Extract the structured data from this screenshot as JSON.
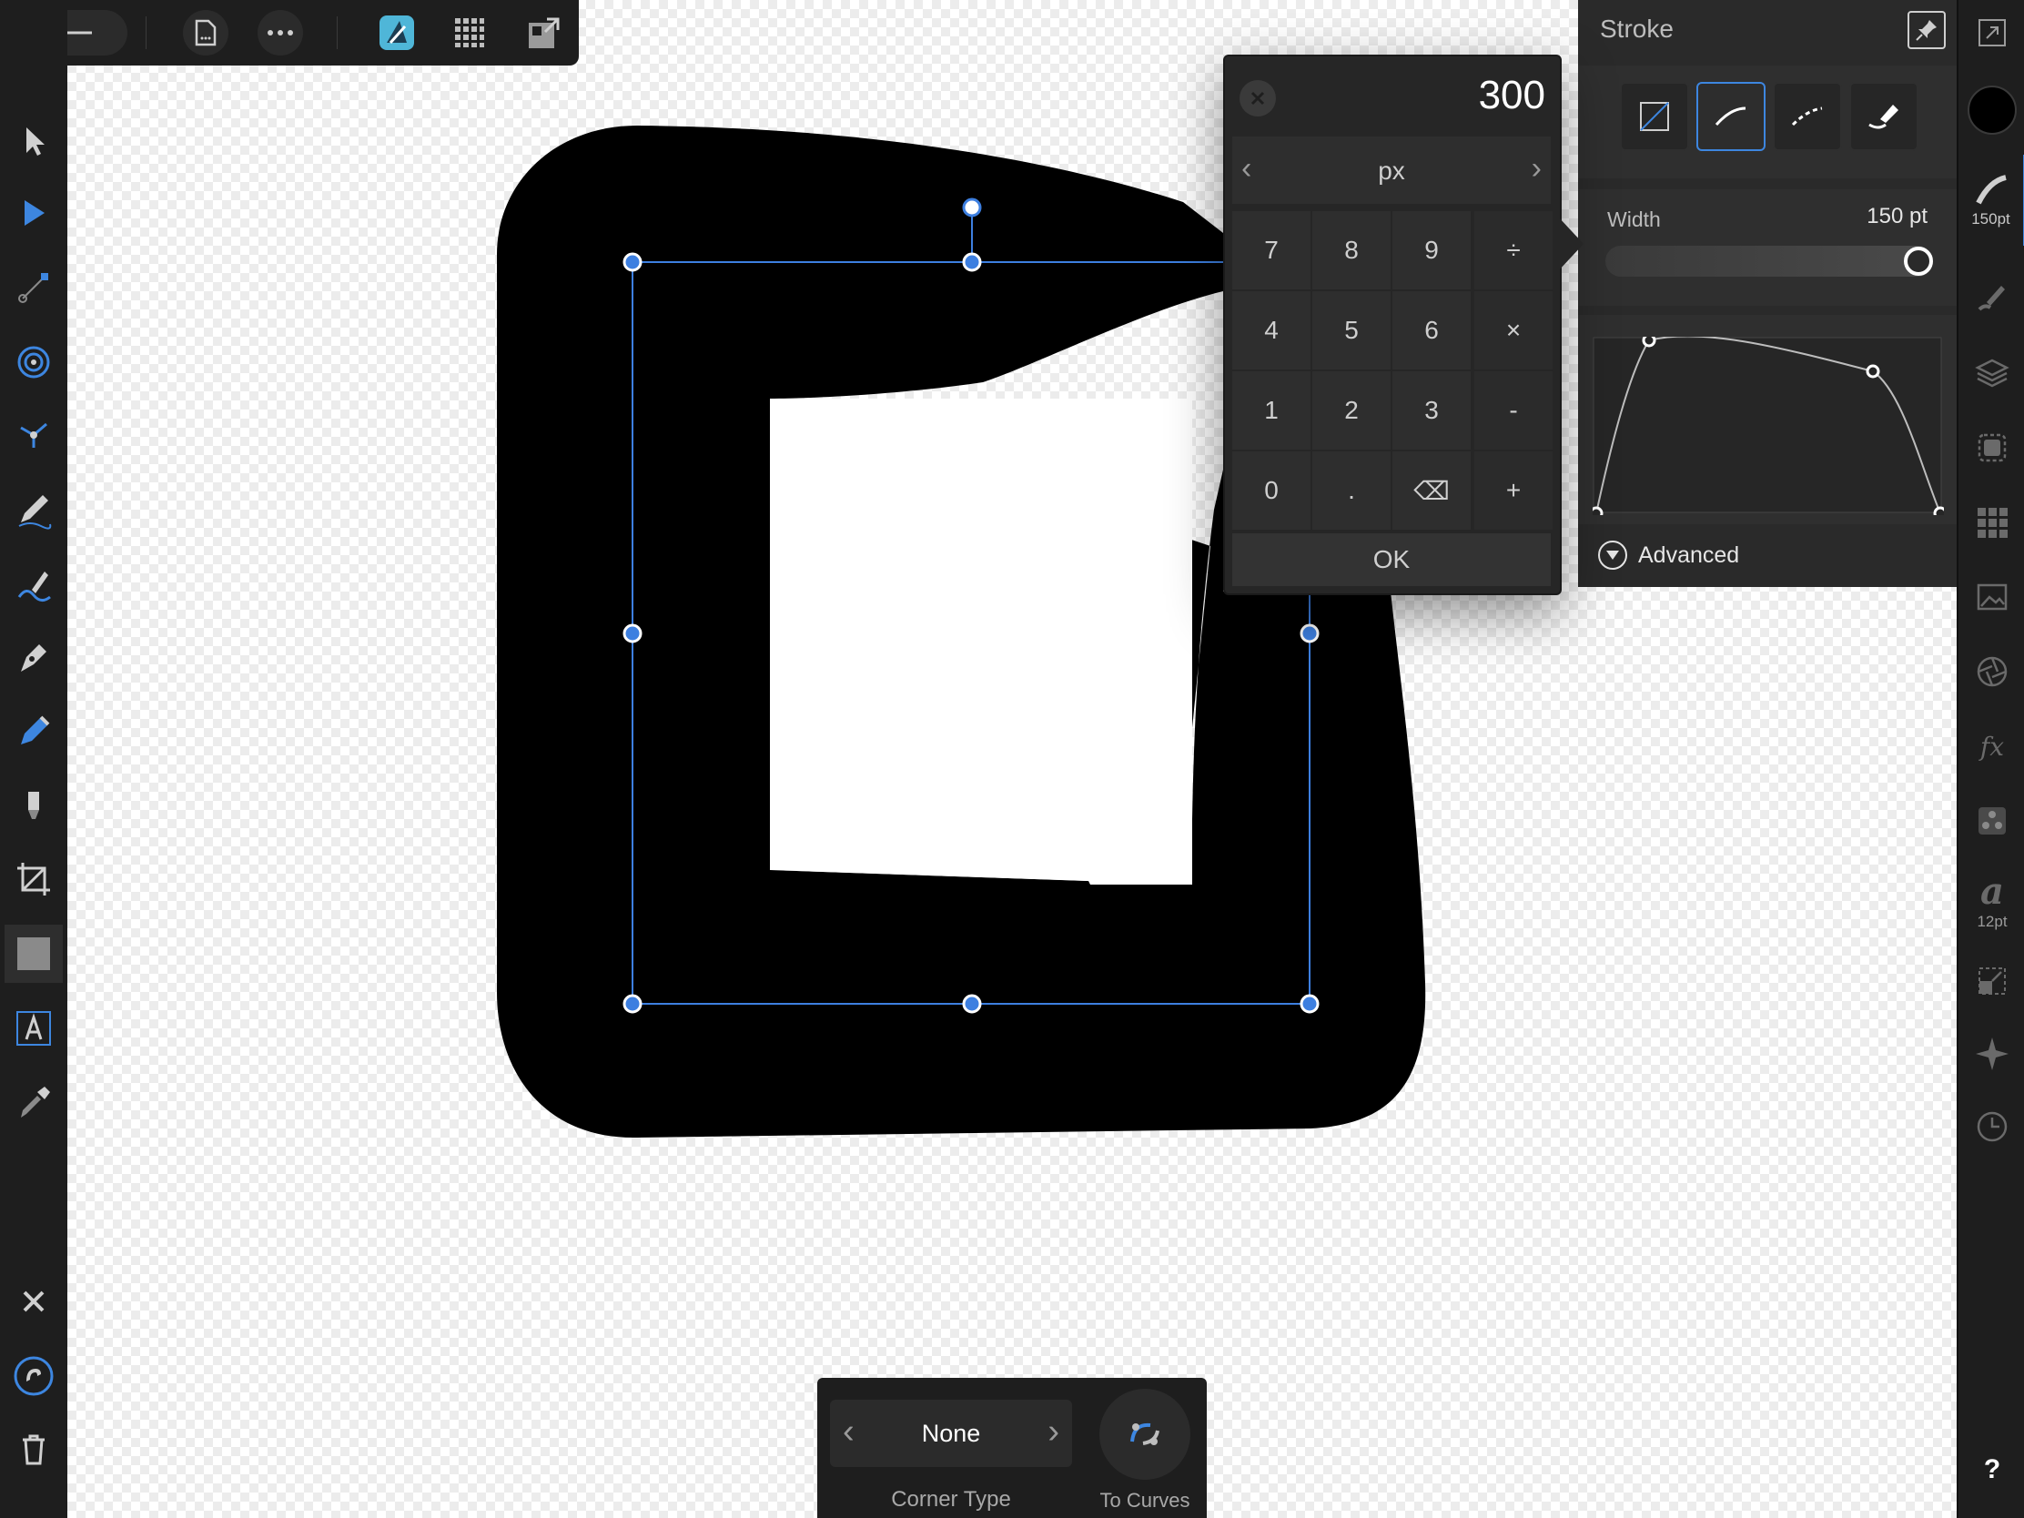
{
  "canvas": {
    "shape_fill": "#000000",
    "selection_color": "#3d7fe0"
  },
  "top_bar": {
    "back_icon": "arrow-left-icon",
    "document_icon": "document-icon",
    "more_icon": "ellipsis-icon",
    "persona_icon": "designer-persona-icon",
    "grid_icon": "grid-icon",
    "export_icon": "export-icon"
  },
  "stroke_panel": {
    "title": "Stroke",
    "pin_icon": "pin-icon",
    "styles": [
      "none-stroke-icon",
      "solid-stroke-icon",
      "dashed-stroke-icon",
      "brush-stroke-icon"
    ],
    "selected_style_index": 1,
    "width_label": "Width",
    "width_value": "150 pt",
    "width_slider_fraction": 0.99,
    "advanced_label": "Advanced"
  },
  "keypad": {
    "display_value": "300",
    "unit": "px",
    "keys": [
      "7",
      "8",
      "9",
      "÷",
      "4",
      "5",
      "6",
      "×",
      "1",
      "2",
      "3",
      "-",
      "0",
      ".",
      "⌫",
      "+"
    ],
    "ok_label": "OK"
  },
  "right_rail": {
    "stroke_size_label": "150pt",
    "text_size_label": "12pt",
    "help_label": "?"
  },
  "context_bar": {
    "corner_value": "None",
    "corner_type_label": "Corner Type",
    "to_curves_label": "To Curves"
  }
}
